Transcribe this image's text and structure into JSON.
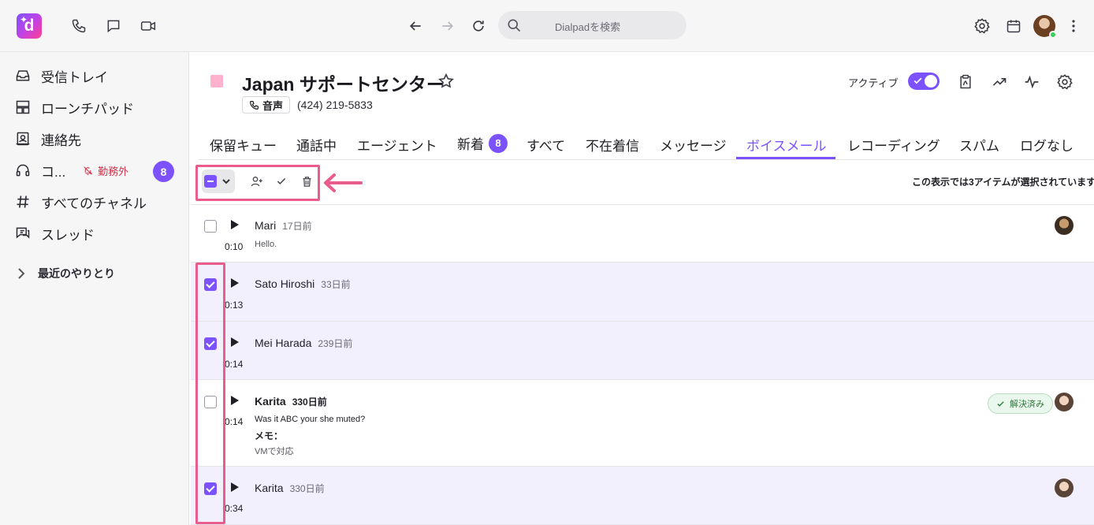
{
  "app": {
    "logo_letter": "d",
    "search_placeholder": "Dialpadを検索",
    "brand_color": "#7c52ff"
  },
  "sidebar": {
    "items": [
      {
        "label": "受信トレイ",
        "icon": "inbox-icon"
      },
      {
        "label": "ローンチパッド",
        "icon": "launchpad-icon"
      },
      {
        "label": "連絡先",
        "icon": "contacts-icon"
      },
      {
        "label": "コ...",
        "icon": "headset-icon",
        "status": "勤務外",
        "badge": "8"
      },
      {
        "label": "すべてのチャネル",
        "icon": "hash-icon"
      },
      {
        "label": "スレッド",
        "icon": "threads-icon"
      }
    ],
    "recent_label": "最近のやりとり"
  },
  "header": {
    "title": "Japan サポートセンター",
    "channel_type": "音声",
    "phone": "(424) 219-5833",
    "active_label": "アクティブ",
    "active_on": true
  },
  "tabs": [
    {
      "label": "保留キュー"
    },
    {
      "label": "通話中"
    },
    {
      "label": "エージェント"
    },
    {
      "label": "新着",
      "badge": "8"
    },
    {
      "label": "すべて"
    },
    {
      "label": "不在着信"
    },
    {
      "label": "メッセージ"
    },
    {
      "label": "ボイスメール",
      "active": true
    },
    {
      "label": "レコーディング"
    },
    {
      "label": "スパム"
    },
    {
      "label": "ログなし"
    }
  ],
  "toolbar": {
    "selection_text": "この表示では3アイテムが選択されています"
  },
  "voicemails": [
    {
      "name": "Mari",
      "ago": "17日前",
      "duration": "0:10",
      "message": "Hello.",
      "checked": false
    },
    {
      "name": "Sato Hiroshi",
      "ago": "33日前",
      "duration": "0:13",
      "checked": true
    },
    {
      "name": "Mei Harada",
      "ago": "239日前",
      "duration": "0:14",
      "checked": true
    },
    {
      "name": "Karita",
      "ago": "330日前",
      "duration": "0:14",
      "message": "Was it ABC your she muted?",
      "memo_label": "メモ：",
      "memo": "VMで対応",
      "status": "解決済み",
      "checked": false,
      "unread": true
    },
    {
      "name": "Karita",
      "ago": "330日前",
      "duration": "0:34",
      "checked": true
    }
  ]
}
